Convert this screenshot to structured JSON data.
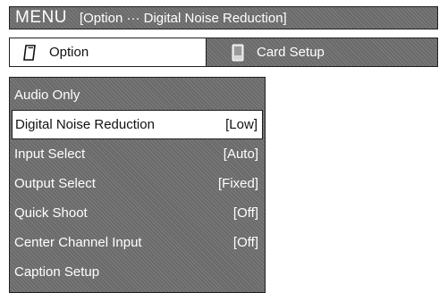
{
  "title_bar": {
    "menu_label": "MENU",
    "path": "[Option ··· Digital Noise Reduction]"
  },
  "tabs": [
    {
      "label": "Option",
      "icon": "option-card-icon",
      "active": true
    },
    {
      "label": "Card Setup",
      "icon": "card-setup-icon",
      "active": false
    }
  ],
  "menu": {
    "items": [
      {
        "label": "Audio Only",
        "value": ""
      },
      {
        "label": "Digital Noise Reduction",
        "value": "[Low]",
        "selected": true
      },
      {
        "label": "Input Select",
        "value": "[Auto]"
      },
      {
        "label": "Output Select",
        "value": "[Fixed]"
      },
      {
        "label": "Quick Shoot",
        "value": "[Off]"
      },
      {
        "label": "Center Channel Input",
        "value": "[Off]"
      },
      {
        "label": "Caption Setup",
        "value": ""
      }
    ]
  },
  "colors": {
    "panel": "#6a6a6a",
    "selected_bg": "#ffffff",
    "text_light": "#ffffff",
    "text_dark": "#111111"
  }
}
